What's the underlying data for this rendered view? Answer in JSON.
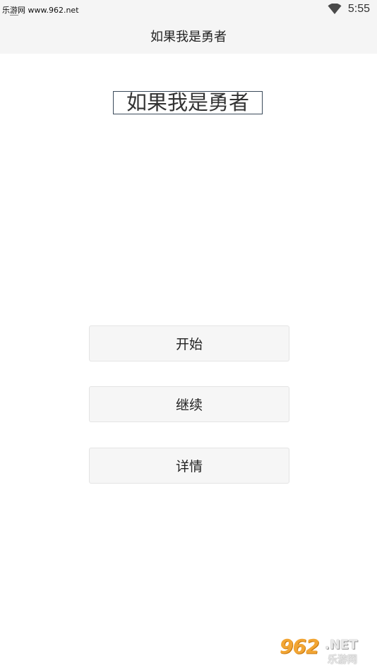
{
  "status_bar": {
    "watermark_text": "乐游网 www.962.net",
    "time": "5:55"
  },
  "app_bar": {
    "title": "如果我是勇者"
  },
  "main": {
    "game_title": "如果我是勇者",
    "buttons": [
      {
        "label": "开始"
      },
      {
        "label": "继续"
      },
      {
        "label": "详情"
      }
    ]
  },
  "logo_watermark": {
    "number": "962",
    "domain": ".NET",
    "name": "乐游网"
  },
  "colors": {
    "header_bg": "#f5f5f5",
    "button_bg": "#f6f6f6",
    "logo_orange": "#f2a533"
  },
  "icons": {
    "wifi": "wifi-icon"
  }
}
